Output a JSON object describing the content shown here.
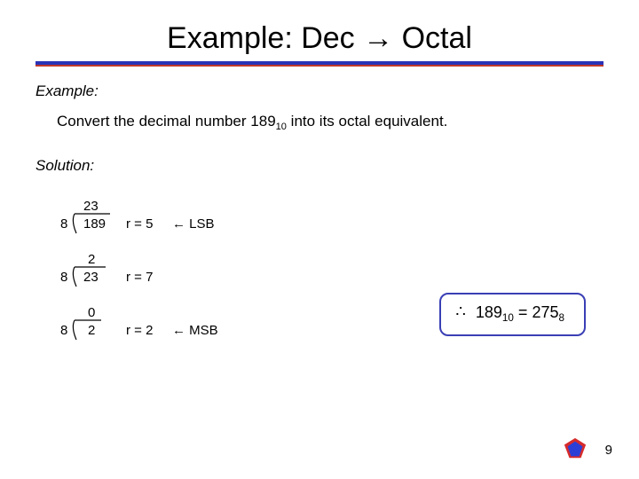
{
  "title": "Example: Dec → Octal",
  "labels": {
    "example": "Example:",
    "solution": "Solution:"
  },
  "problem": {
    "pre": "Convert the decimal number ",
    "num": "189",
    "base": "10",
    "post": " into its octal equivalent."
  },
  "work": {
    "divisor": "8",
    "steps": [
      {
        "quotient": "23",
        "dividend": "189",
        "r_label": "r = 5",
        "tag": "← LSB"
      },
      {
        "quotient": "2",
        "dividend": "23",
        "r_label": "r = 7",
        "tag": ""
      },
      {
        "quotient": "0",
        "dividend": "2",
        "r_label": "r = 2",
        "tag": "← MSB"
      }
    ]
  },
  "answer": {
    "therefore": "∴",
    "lhs_num": "189",
    "lhs_base": "10",
    "rhs_num": "275",
    "rhs_base": "8"
  },
  "page": "9"
}
